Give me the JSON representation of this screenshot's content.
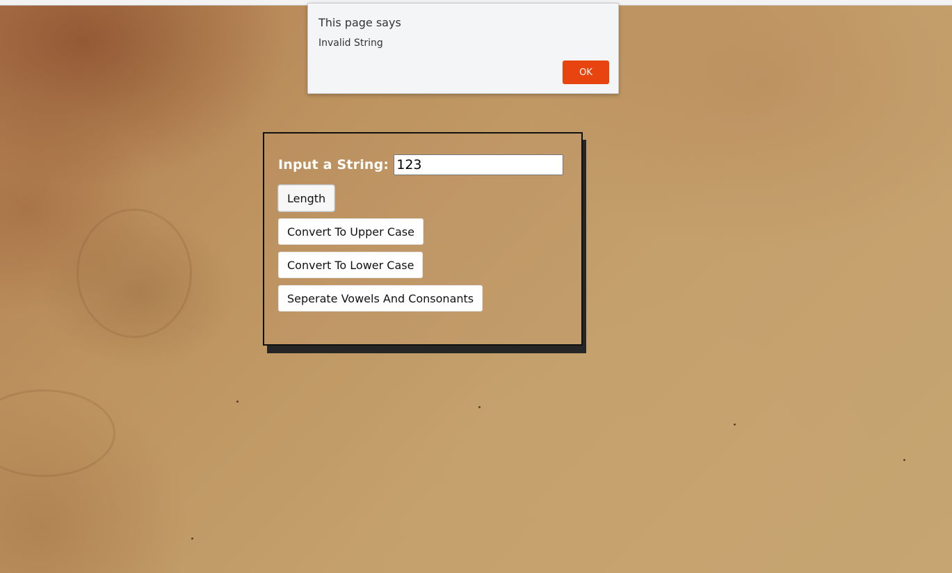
{
  "dialog": {
    "title": "This page says",
    "message": "Invalid String",
    "ok_label": "OK",
    "ok_color": "#e8440f"
  },
  "form": {
    "input_label": "Input a String:",
    "input_value": "123",
    "buttons": {
      "length": "Length",
      "upper": "Convert To Upper Case",
      "lower": "Convert To Lower Case",
      "vowels": "Seperate Vowels And Consonants"
    }
  }
}
